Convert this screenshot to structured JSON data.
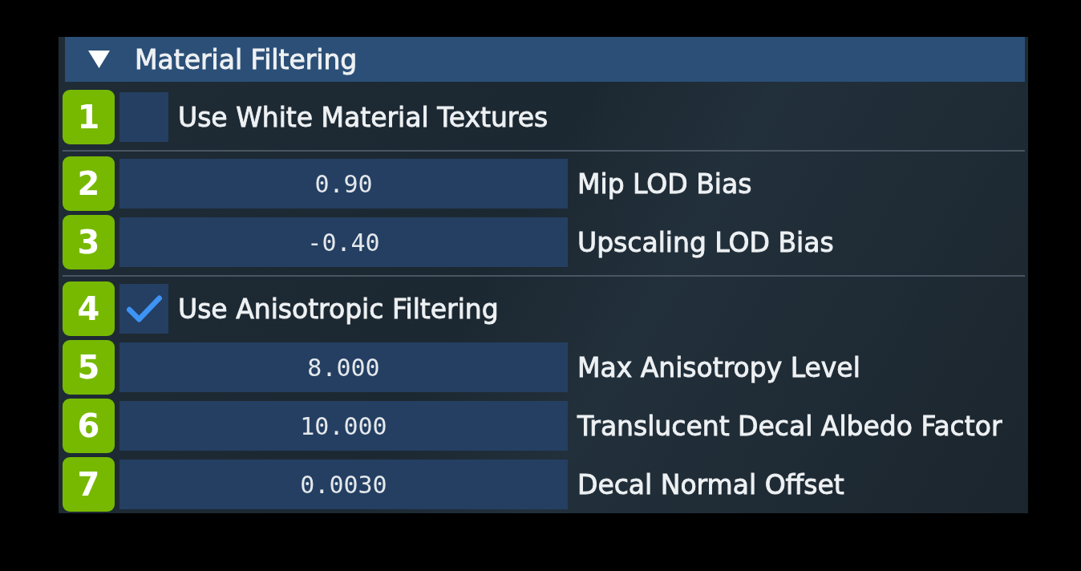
{
  "section": {
    "title": "Material Filtering",
    "expanded": true
  },
  "groups": [
    {
      "rows": [
        {
          "badge": "1",
          "kind": "checkbox",
          "text": "Use White Material Textures",
          "checked": false
        }
      ]
    },
    {
      "rows": [
        {
          "badge": "2",
          "kind": "number",
          "value": "0.90",
          "label": "Mip LOD Bias"
        },
        {
          "badge": "3",
          "kind": "number",
          "value": "-0.40",
          "label": "Upscaling LOD Bias"
        }
      ]
    },
    {
      "rows": [
        {
          "badge": "4",
          "kind": "checkbox",
          "text": "Use Anisotropic Filtering",
          "checked": true
        },
        {
          "badge": "5",
          "kind": "number",
          "value": "8.000",
          "label": "Max Anisotropy Level"
        },
        {
          "badge": "6",
          "kind": "number",
          "value": "10.000",
          "label": "Translucent Decal Albedo Factor"
        },
        {
          "badge": "7",
          "kind": "number",
          "value": "0.0030",
          "label": "Decal Normal Offset"
        }
      ]
    }
  ]
}
